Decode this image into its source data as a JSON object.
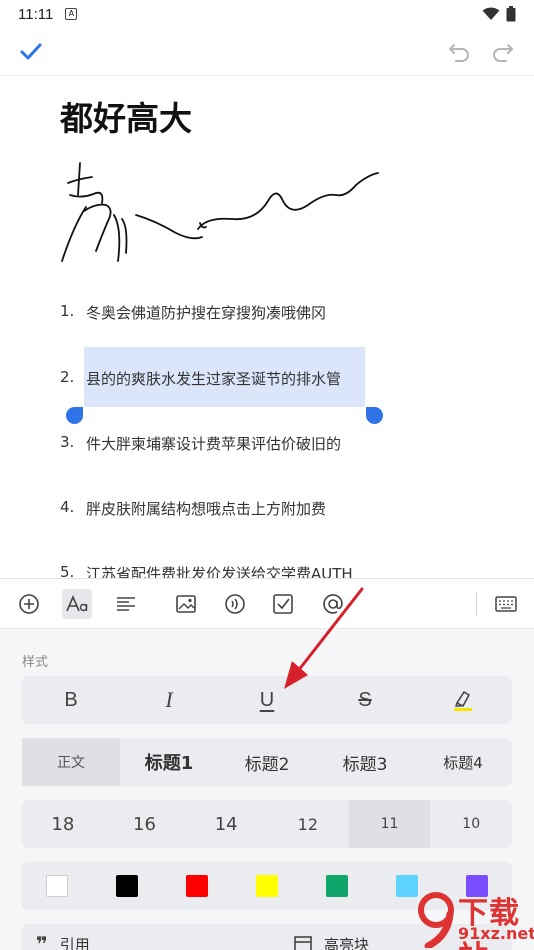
{
  "status_bar": {
    "time": "11:11",
    "notif_letter": "A"
  },
  "document": {
    "title": "都好高大",
    "list": [
      {
        "num": "1.",
        "text": "冬奥会佛道防护搜在穿搜狗凑哦佛冈"
      },
      {
        "num": "2.",
        "text": "县的的爽肤水发生过家圣诞节的排水管"
      },
      {
        "num": "3.",
        "text": "件大胖柬埔寨设计费苹果评估价破旧的"
      },
      {
        "num": "4.",
        "text": "胖皮肤附属结构想哦点击上方附加费"
      },
      {
        "num": "5.",
        "text": "江苏省配件费批发价发送给交学费AUTH"
      }
    ]
  },
  "format_panel": {
    "section_label": "样式",
    "styles": {
      "bold": "B",
      "italic": "I",
      "underline": "U",
      "strike": "S"
    },
    "headings": [
      "正文",
      "标题1",
      "标题2",
      "标题3",
      "标题4"
    ],
    "sizes": [
      "18",
      "16",
      "14",
      "12",
      "11",
      "10"
    ],
    "selected_size": "11",
    "colors": [
      "#ffffff",
      "#000000",
      "#ff0000",
      "#ffff00",
      "#0fa56b",
      "#5fd3ff",
      "#7a4dff"
    ],
    "bottom": {
      "quote": "引用",
      "highlight_block": "高亮块"
    }
  },
  "watermark": {
    "brand": "下载站",
    "site": "91xz.net"
  }
}
